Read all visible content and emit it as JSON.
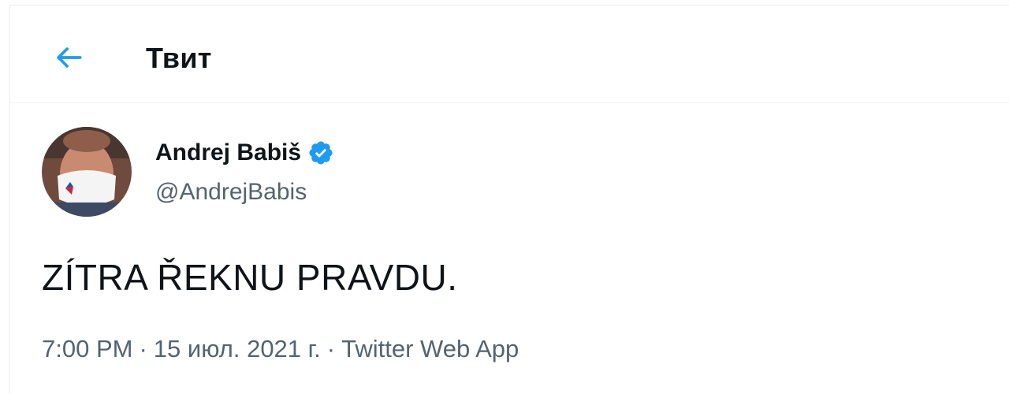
{
  "header": {
    "back_icon": "arrow-left-icon",
    "title": "Твит"
  },
  "colors": {
    "accent": "#1d9bf0",
    "text_primary": "#0f1419",
    "text_secondary": "#536471",
    "verified": "#1d9bf0"
  },
  "tweet": {
    "author": {
      "display_name": "Andrej Babiš",
      "handle": "@AndrejBabis",
      "verified_icon": "verified-badge-icon"
    },
    "text": "ZÍTRA ŘEKNU PRAVDU.",
    "meta": {
      "time": "7:00 PM",
      "separator1": "·",
      "date": "15 июл. 2021 г.",
      "separator2": "·",
      "source": "Twitter Web App"
    }
  }
}
